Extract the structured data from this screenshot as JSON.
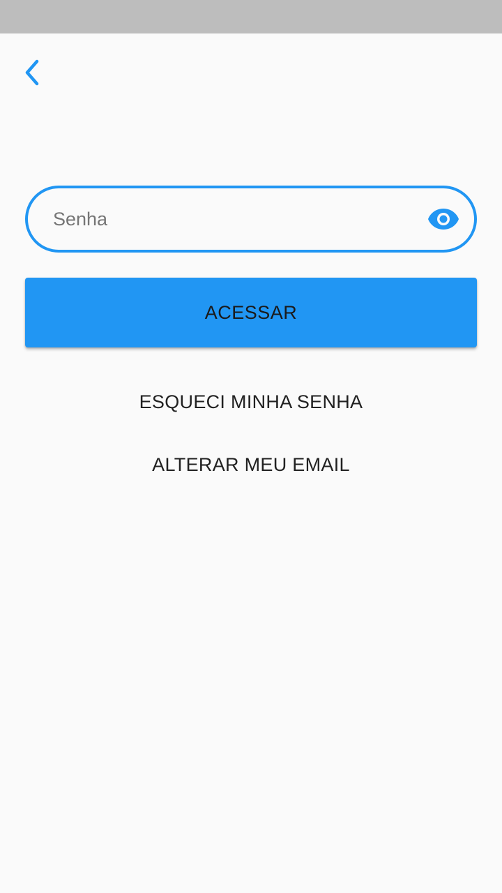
{
  "header": {
    "back_icon": "chevron-left-icon"
  },
  "password_field": {
    "placeholder": "Senha",
    "value": "",
    "toggle_icon": "eye-icon"
  },
  "actions": {
    "access_label": "ACESSAR",
    "forgot_password_label": "ESQUECI MINHA SENHA",
    "change_email_label": "ALTERAR MEU EMAIL"
  },
  "colors": {
    "accent": "#2196f3",
    "status_bar": "#bdbdbd",
    "background": "#fafafa"
  }
}
